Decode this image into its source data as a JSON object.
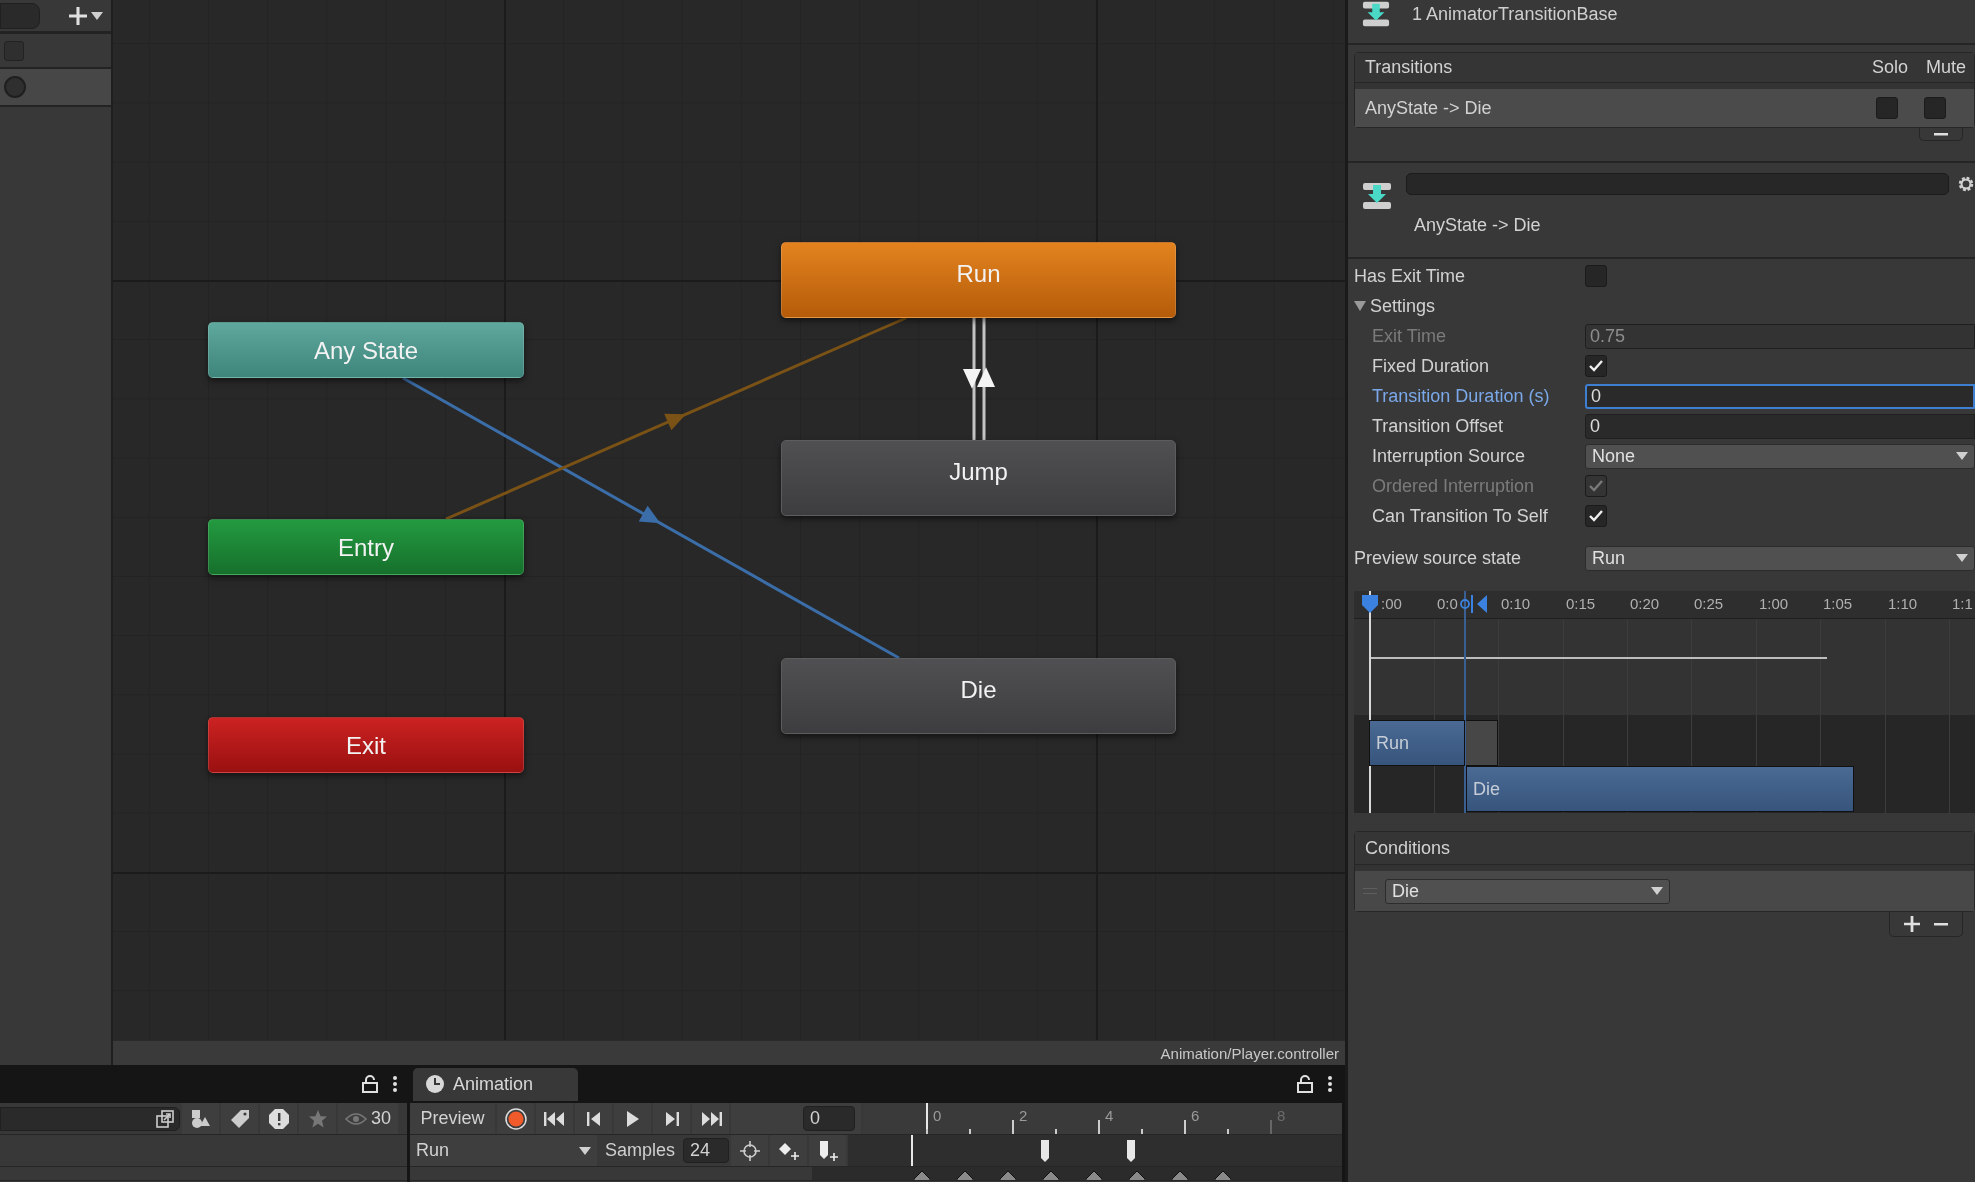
{
  "graph": {
    "states": [
      {
        "label": "Any State",
        "kind": "any"
      },
      {
        "label": "Entry",
        "kind": "entry"
      },
      {
        "label": "Exit",
        "kind": "exit"
      },
      {
        "label": "Run",
        "kind": "default"
      },
      {
        "label": "Jump",
        "kind": "normal"
      },
      {
        "label": "Die",
        "kind": "normal"
      }
    ],
    "transitions": [
      {
        "kind": "single",
        "color": "#3b6ea8"
      },
      {
        "kind": "single",
        "color": "#7a5216"
      },
      {
        "kind": "double",
        "color": "#c4c4c4"
      }
    ],
    "status_path": "Animation/Player.controller"
  },
  "inspector": {
    "title": "1 AnimatorTransitionBase",
    "transitions_list": {
      "columns": [
        "Transitions",
        "Solo",
        "Mute"
      ],
      "rows": [
        {
          "name": "AnyState -> Die",
          "solo": false,
          "mute": false
        }
      ]
    },
    "transition_caption": "AnyState -> Die",
    "properties": [
      {
        "kind": "checkbox",
        "label": "Has Exit Time",
        "checked": false,
        "disabled": false
      },
      {
        "kind": "foldout",
        "label": "Settings",
        "expanded": true,
        "children": [
          {
            "kind": "number",
            "label": "Exit Time",
            "value": "0.75",
            "disabled": true,
            "focused": false
          },
          {
            "kind": "checkbox",
            "label": "Fixed Duration",
            "checked": true,
            "disabled": false
          },
          {
            "kind": "number",
            "label": "Transition Duration (s)",
            "value": "0",
            "disabled": false,
            "focused": true
          },
          {
            "kind": "number",
            "label": "Transition Offset",
            "value": "0",
            "disabled": false,
            "focused": false
          },
          {
            "kind": "dropdown",
            "label": "Interruption Source",
            "value": "None"
          },
          {
            "kind": "checkbox",
            "label": "Ordered Interruption",
            "checked": true,
            "disabled": true
          },
          {
            "kind": "checkbox",
            "label": "Can Transition To Self",
            "checked": true,
            "disabled": false
          }
        ]
      }
    ],
    "preview_source": {
      "label": "Preview source state",
      "value": "Run"
    },
    "timeline": {
      "ruler_labels": [
        ":00",
        "0:0",
        "0:10",
        "0:15",
        "0:20",
        "0:25",
        "1:00",
        "1:05",
        "1:10",
        "1:1"
      ],
      "clips": [
        {
          "label": "Run"
        },
        {
          "label": "Die"
        }
      ]
    },
    "conditions": {
      "title": "Conditions",
      "rows": [
        {
          "parameter": "Die"
        }
      ]
    }
  },
  "bottom": {
    "visible_count": "30",
    "tab": "Animation",
    "preview": "Preview",
    "frame": "0",
    "clip": "Run",
    "samples_label": "Samples",
    "samples": "24",
    "ruler": [
      "0",
      "2",
      "4",
      "6",
      "8"
    ]
  }
}
